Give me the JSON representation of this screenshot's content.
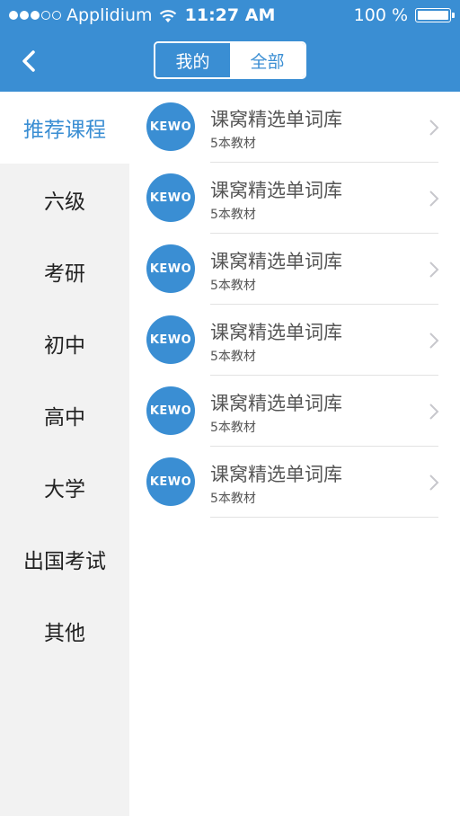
{
  "status_bar": {
    "carrier": "Applidium",
    "time": "11:27 AM",
    "battery": "100 %"
  },
  "nav": {
    "back_icon": "chevron-left-icon",
    "segments": [
      "我的",
      "全部"
    ],
    "selected_segment": "全部"
  },
  "sidebar": {
    "items": [
      {
        "label": "推荐课程",
        "active": true
      },
      {
        "label": "六级"
      },
      {
        "label": "考研"
      },
      {
        "label": "初中"
      },
      {
        "label": "高中"
      },
      {
        "label": "大学"
      },
      {
        "label": "出国考试"
      },
      {
        "label": "其他"
      }
    ]
  },
  "list": {
    "items": [
      {
        "logo": "KEWO",
        "title": "课窝精选单词库",
        "subtitle": "5本教材"
      },
      {
        "logo": "KEWO",
        "title": "课窝精选单词库",
        "subtitle": "5本教材"
      },
      {
        "logo": "KEWO",
        "title": "课窝精选单词库",
        "subtitle": "5本教材"
      },
      {
        "logo": "KEWO",
        "title": "课窝精选单词库",
        "subtitle": "5本教材"
      },
      {
        "logo": "KEWO",
        "title": "课窝精选单词库",
        "subtitle": "5本教材"
      },
      {
        "logo": "KEWO",
        "title": "课窝精选单词库",
        "subtitle": "5本教材"
      }
    ]
  },
  "colors": {
    "accent": "#3a8ed3",
    "sidebar_bg": "#f2f2f2"
  }
}
